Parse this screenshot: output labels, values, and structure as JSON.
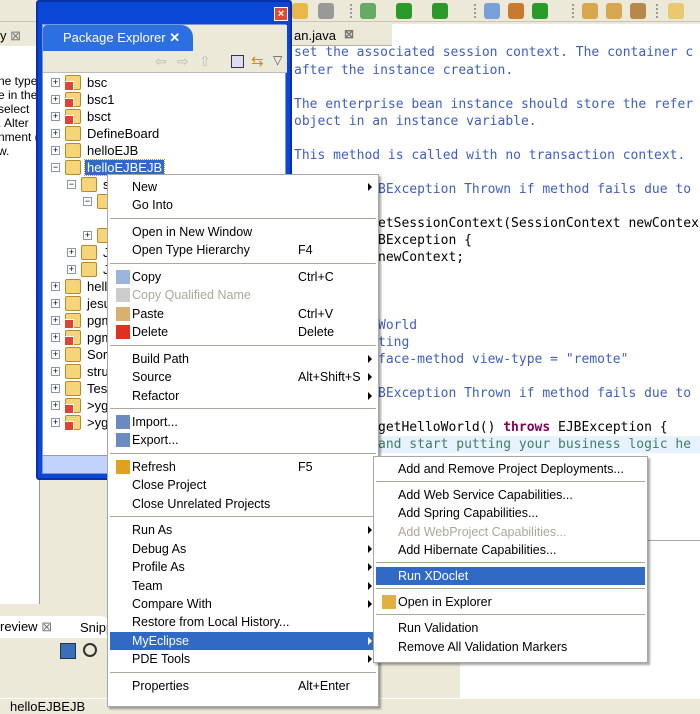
{
  "left_view": {
    "tab_label": "y",
    "text_lines": [
      "ne type",
      "e in the",
      "select",
      ". Alter",
      "nment (e",
      "w."
    ]
  },
  "package_explorer": {
    "title": "Package Explorer",
    "tree": [
      {
        "label": "bsc",
        "expander": "+",
        "error": true
      },
      {
        "label": "bsc1",
        "expander": "+",
        "error": true
      },
      {
        "label": "bsct",
        "expander": "+",
        "error": true
      },
      {
        "label": "DefineBoard",
        "expander": "+",
        "error": false
      },
      {
        "label": "helloEJB",
        "expander": "+",
        "error": false
      },
      {
        "label": "helloEJBEJB",
        "expander": "-",
        "error": false,
        "selected": true
      },
      {
        "label": "s",
        "expander": "-",
        "indent": 1
      },
      {
        "label": "",
        "expander": "-",
        "indent": 2
      },
      {
        "label": "",
        "expander": "",
        "indent": 3
      },
      {
        "label": "",
        "expander": "+",
        "indent": 2
      },
      {
        "label": "J",
        "expander": "+",
        "indent": 1
      },
      {
        "label": "J",
        "expander": "+",
        "indent": 1
      },
      {
        "label": "hell",
        "expander": "+"
      },
      {
        "label": "jesu",
        "expander": "+"
      },
      {
        "label": "pgm",
        "expander": "+",
        "error": true
      },
      {
        "label": "pgm",
        "expander": "+",
        "error": true
      },
      {
        "label": "Sort",
        "expander": "+"
      },
      {
        "label": "stru",
        "expander": "+"
      },
      {
        "label": "Tes",
        "expander": "+"
      },
      {
        "label": ">yg",
        "expander": "+",
        "error": true
      },
      {
        "label": ">yg",
        "expander": "+",
        "error": true
      }
    ]
  },
  "editor": {
    "tab_label": "an.java",
    "lines": [
      {
        "text": "set the associated session context. The container c",
        "x": "l"
      },
      {
        "text": "after the instance creation.",
        "x": "l"
      },
      {
        "text": "The enterprise bean instance should store the refer",
        "x": "l"
      },
      {
        "text": "object in an instance variable.",
        "x": "l"
      },
      {
        "text": "This method is called with no transaction context.",
        "x": "l"
      },
      {
        "text": "BException Thrown if method fails due to",
        "x": "r"
      },
      {
        "text": "etSessionContext(SessionContext newContex",
        "x": "r",
        "code": true
      },
      {
        "text": "BException {",
        "x": "r",
        "code": true
      },
      {
        "text": "newContext;",
        "x": "r",
        "code": true
      },
      {
        "text": "World",
        "x": "r"
      },
      {
        "text": "ting",
        "x": "r"
      },
      {
        "text": "face-method view-type = \"remote\"",
        "x": "r"
      },
      {
        "text": "BException Thrown if method fails due to",
        "x": "r"
      },
      {
        "text": "getHelloWorld() ",
        "kw": "throws",
        "after": " EJBException {",
        "x": "r",
        "code": true
      },
      {
        "text": "and start putting your business logic he",
        "x": "r",
        "comment": true
      }
    ]
  },
  "context_menu": [
    {
      "label": "New",
      "submenu": true
    },
    {
      "label": "Go Into"
    },
    {
      "sep": true
    },
    {
      "label": "Open in New Window"
    },
    {
      "label": "Open Type Hierarchy",
      "shortcut": "F4"
    },
    {
      "sep": true
    },
    {
      "label": "Copy",
      "shortcut": "Ctrl+C",
      "icon": "copy-icon"
    },
    {
      "label": "Copy Qualified Name",
      "disabled": true,
      "icon": "copy-qualified-name-icon"
    },
    {
      "label": "Paste",
      "shortcut": "Ctrl+V",
      "icon": "paste-icon"
    },
    {
      "label": "Delete",
      "shortcut": "Delete",
      "icon": "delete-icon"
    },
    {
      "sep": true
    },
    {
      "label": "Build Path",
      "submenu": true
    },
    {
      "label": "Source",
      "shortcut": "Alt+Shift+S",
      "submenu": true
    },
    {
      "label": "Refactor",
      "submenu": true
    },
    {
      "sep": true
    },
    {
      "label": "Import...",
      "icon": "import-icon"
    },
    {
      "label": "Export...",
      "icon": "export-icon"
    },
    {
      "sep": true
    },
    {
      "label": "Refresh",
      "shortcut": "F5",
      "icon": "refresh-icon"
    },
    {
      "label": "Close Project"
    },
    {
      "label": "Close Unrelated Projects"
    },
    {
      "sep": true
    },
    {
      "label": "Run As",
      "submenu": true
    },
    {
      "label": "Debug As",
      "submenu": true
    },
    {
      "label": "Profile As",
      "submenu": true
    },
    {
      "label": "Team",
      "submenu": true
    },
    {
      "label": "Compare With",
      "submenu": true
    },
    {
      "label": "Restore from Local History..."
    },
    {
      "label": "MyEclipse",
      "submenu": true,
      "selected": true
    },
    {
      "label": "PDE Tools",
      "submenu": true
    },
    {
      "sep": true
    },
    {
      "label": "Properties",
      "shortcut": "Alt+Enter"
    }
  ],
  "myeclipse_submenu": [
    {
      "label": "Add and Remove Project Deployments..."
    },
    {
      "sep": true
    },
    {
      "label": "Add Web Service Capabilities..."
    },
    {
      "label": "Add Spring Capabilities..."
    },
    {
      "label": "Add WebProject Capabilities...",
      "disabled": true
    },
    {
      "label": "Add Hibernate Capabilities..."
    },
    {
      "sep": true
    },
    {
      "label": "Run XDoclet",
      "selected": true
    },
    {
      "sep": true
    },
    {
      "label": "Open in Explorer",
      "icon": "open-folder-icon"
    },
    {
      "sep": true
    },
    {
      "label": "Run Validation"
    },
    {
      "label": "Remove All Validation Markers"
    }
  ],
  "bottom_left": {
    "tab_label": "review",
    "tab2_label": "Snipp"
  },
  "status_bar": {
    "text": "helloEJBEJB"
  },
  "colors": {
    "selection": "#316ac5",
    "window_blue": "#0a47d6",
    "comment": "#3f5fbf",
    "keyword": "#7f0055",
    "disabled": "#aca899"
  }
}
